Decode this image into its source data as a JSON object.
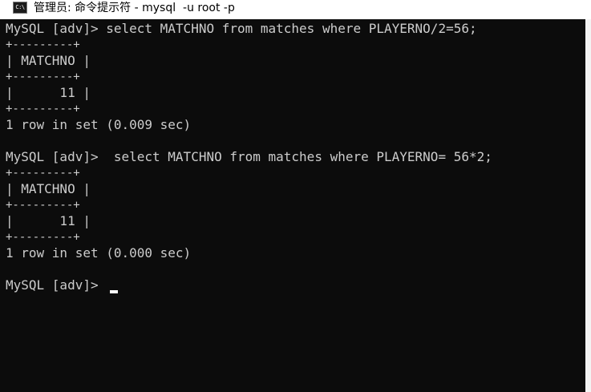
{
  "window": {
    "title": "管理员: 命令提示符 - mysql  -u root -p",
    "icon_label": "C:\\"
  },
  "console": {
    "lines": [
      "MySQL [adv]> select MATCHNO from matches where PLAYERNO/2=56;",
      "+---------+",
      "| MATCHNO |",
      "+---------+",
      "|      11 |",
      "+---------+",
      "1 row in set (0.009 sec)",
      "",
      "MySQL [adv]>  select MATCHNO from matches where PLAYERNO= 56*2;",
      "+---------+",
      "| MATCHNO |",
      "+---------+",
      "|      11 |",
      "+---------+",
      "1 row in set (0.000 sec)",
      "",
      "MySQL [adv]> "
    ]
  }
}
